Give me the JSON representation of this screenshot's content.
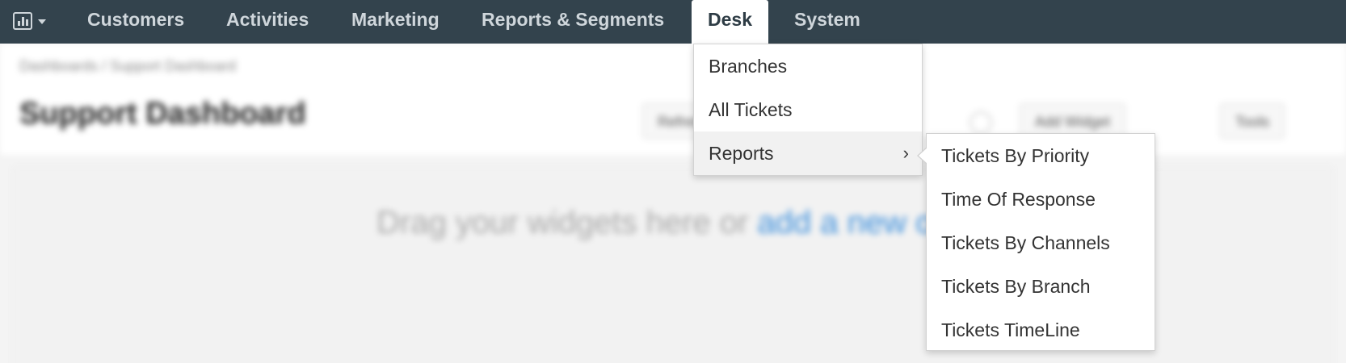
{
  "nav": {
    "items": [
      "Customers",
      "Activities",
      "Marketing",
      "Reports & Segments",
      "Desk",
      "System"
    ],
    "active": "Desk"
  },
  "background": {
    "breadcrumb": "Dashboards / Support Dashboard",
    "title": "Support Dashboard",
    "buttons": [
      "Refresh",
      "Add Widget",
      "Tools"
    ],
    "drop_text": "Drag your widgets here or ",
    "drop_link": "add a new one"
  },
  "menu": {
    "items": [
      "Branches",
      "All Tickets",
      "Reports"
    ]
  },
  "submenu": {
    "items": [
      "Tickets By Priority",
      "Time Of Response",
      "Tickets By Channels",
      "Tickets By Branch",
      "Tickets TimeLine"
    ]
  },
  "icons": {
    "app_switch": "bar-chart-icon",
    "caret": "caret-down-icon",
    "submenu_arrow": "chevron-right-icon"
  },
  "colors": {
    "nav_bg": "#33434d",
    "nav_text": "#cfd6db",
    "link": "#3d8fdc"
  }
}
